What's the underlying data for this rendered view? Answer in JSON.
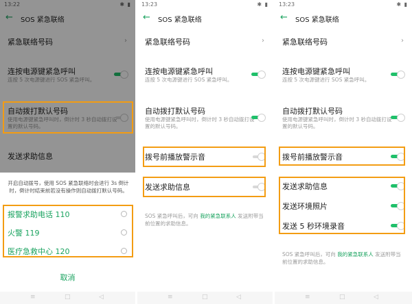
{
  "colors": {
    "accent": "#1aa35f",
    "toggle_on": "#1fc06a",
    "highlight": "#f39c12"
  },
  "screens": [
    {
      "time": "13:22",
      "title": "SOS 紧急联络",
      "contact_label": "紧急联络号码",
      "power_label": "连按电源键紧急呼叫",
      "power_sub": "连按 5 次电源键进行 SOS 紧急呼叫。",
      "auto_dial_label": "自动拨打默认号码",
      "auto_dial_sub": "使用电源键紧急呼叫时，倒计时 3 秒自动拨打设置的默认号码。",
      "send_label": "发送求助信息",
      "dialog": {
        "desc": "开启自动拨号，使用 SOS 紧急联络时会进行 3s 倒计时，倒计时结束前若没有操作则自动拨打默认号码。",
        "options": [
          "报警求助电话 110",
          "火警 119",
          "医疗急救中心 120"
        ],
        "cancel": "取消"
      }
    },
    {
      "time": "13:23",
      "title": "SOS 紧急联络",
      "contact_label": "紧急联络号码",
      "power_label": "连按电源键紧急呼叫",
      "power_sub": "连按 5 次电源键进行 SOS 紧急呼叫。",
      "auto_dial_label": "自动拨打默认号码",
      "auto_dial_sub": "使用电源键紧急呼叫时，倒计时 3 秒自动拨打设置的默认号码。",
      "warning_label": "拨号前播放警示音",
      "send_label": "发送求助信息",
      "footer_pre": "SOS 紧急呼叫后，可向 ",
      "footer_link": "我的紧急联系人",
      "footer_post": " 发送附带当前位置的求助信息。"
    },
    {
      "time": "13:23",
      "title": "SOS 紧急联络",
      "contact_label": "紧急联络号码",
      "power_label": "连按电源键紧急呼叫",
      "power_sub": "连按 5 次电源键进行 SOS 紧急呼叫。",
      "auto_dial_label": "自动拨打默认号码",
      "auto_dial_sub": "使用电源键紧急呼叫时，倒计时 3 秒自动拨打设置的默认号码。",
      "warning_label": "拨号前播放警示音",
      "send_label": "发送求助信息",
      "photo_label": "发送环境照片",
      "audio_label": "发送 5 秒环境录音",
      "footer_pre": "SOS 紧急呼叫后，可向 ",
      "footer_link": "我的紧急联系人",
      "footer_post": " 发送附带当前位置的求助信息。"
    }
  ]
}
